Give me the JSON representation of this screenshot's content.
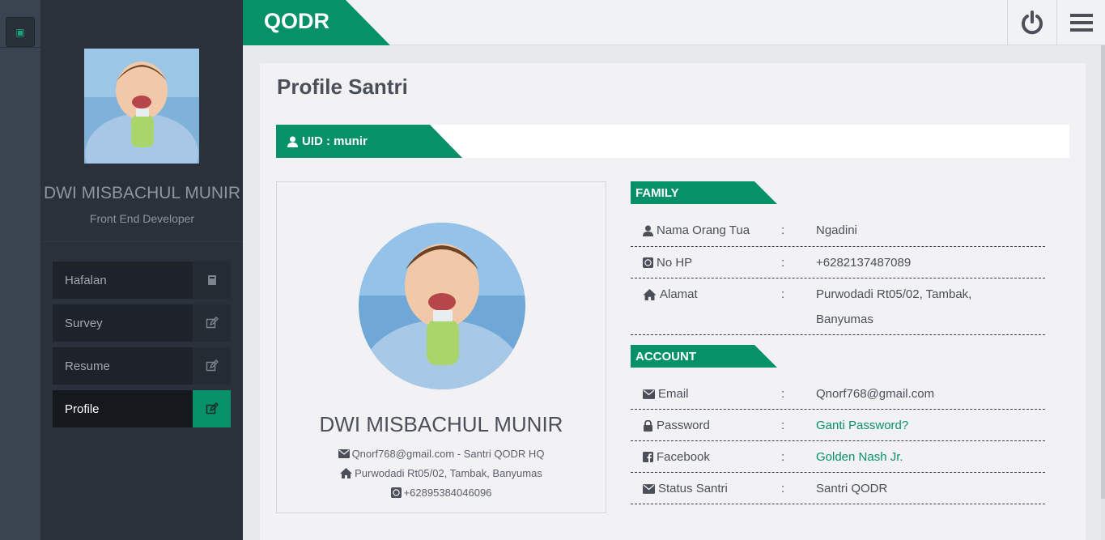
{
  "brand": "QODR",
  "sidebar": {
    "name": "DWI MISBACHUL MUNIR",
    "role": "Front End Developer",
    "menu": [
      {
        "label": "Hafalan",
        "icon": "book-icon"
      },
      {
        "label": "Survey",
        "icon": "edit-icon"
      },
      {
        "label": "Resume",
        "icon": "edit-icon"
      },
      {
        "label": "Profile",
        "icon": "edit-icon",
        "active": true
      }
    ]
  },
  "page": {
    "title": "Profile Santri",
    "uid": "UID : munir"
  },
  "card": {
    "name": "DWI MISBACHUL MUNIR",
    "email_line": "Qnorf768@gmail.com - Santri QODR HQ",
    "address_line": "Purwodadi Rt05/02, Tambak, Banyumas",
    "phone_line": "+62895384046096"
  },
  "family": {
    "heading": "FAMILY",
    "rows": [
      {
        "label": "Nama Orang Tua",
        "value": "Ngadini",
        "icon": "user-icon"
      },
      {
        "label": "No HP",
        "value": "+6282137487089",
        "icon": "whatsapp-icon"
      },
      {
        "label": "Alamat",
        "value": "Purwodadi Rt05/02, Tambak, Banyumas",
        "icon": "home-icon"
      }
    ]
  },
  "account": {
    "heading": "ACCOUNT",
    "rows": [
      {
        "label": "Email",
        "value": "Qnorf768@gmail.com",
        "icon": "envelope-icon"
      },
      {
        "label": "Password",
        "value": "Ganti Password?",
        "icon": "lock-icon",
        "link": true
      },
      {
        "label": "Facebook",
        "value": "Golden Nash Jr.",
        "icon": "facebook-icon",
        "link": true
      },
      {
        "label": "Status Santri",
        "value": "Santri QODR",
        "icon": "envelope-icon"
      }
    ]
  },
  "separator": ":",
  "colors": {
    "accent": "#079169",
    "sidebar": "#2b313a",
    "rail": "#3a4350"
  }
}
